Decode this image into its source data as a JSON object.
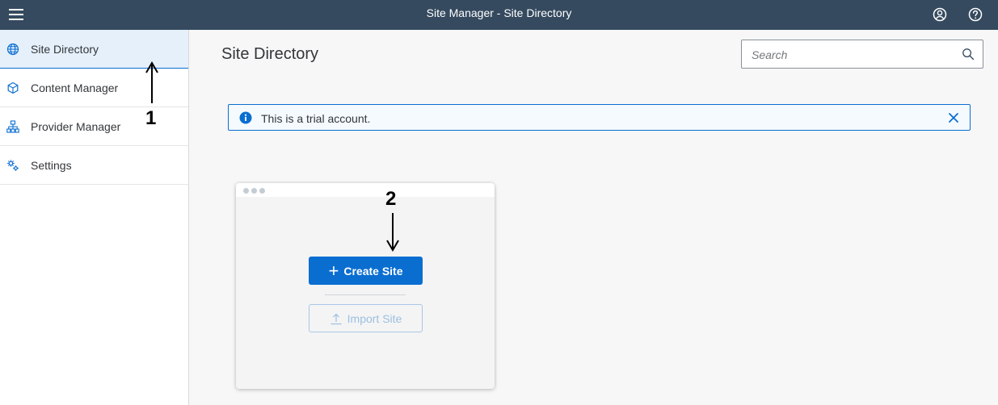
{
  "shell": {
    "title": "Site Manager - Site Directory",
    "menu_icon": "hamburger-icon",
    "user_icon": "user-circle-icon",
    "help_icon": "help-icon"
  },
  "sidebar": {
    "items": [
      {
        "label": "Site Directory",
        "icon": "globe-icon",
        "selected": true
      },
      {
        "label": "Content Manager",
        "icon": "cube-icon",
        "selected": false
      },
      {
        "label": "Provider Manager",
        "icon": "hierarchy-icon",
        "selected": false
      },
      {
        "label": "Settings",
        "icon": "gears-icon",
        "selected": false
      }
    ]
  },
  "main": {
    "title": "Site Directory",
    "search": {
      "placeholder": "Search",
      "value": ""
    },
    "message": {
      "text": "This is a trial account.",
      "type": "information"
    },
    "tile": {
      "create_label": "Create Site",
      "import_label": "Import Site"
    }
  },
  "annotations": {
    "label_1": "1",
    "label_2": "2"
  },
  "colors": {
    "shell_bg": "#354a5f",
    "accent": "#0a6ed1",
    "selected_bg": "#e5f0fa"
  }
}
